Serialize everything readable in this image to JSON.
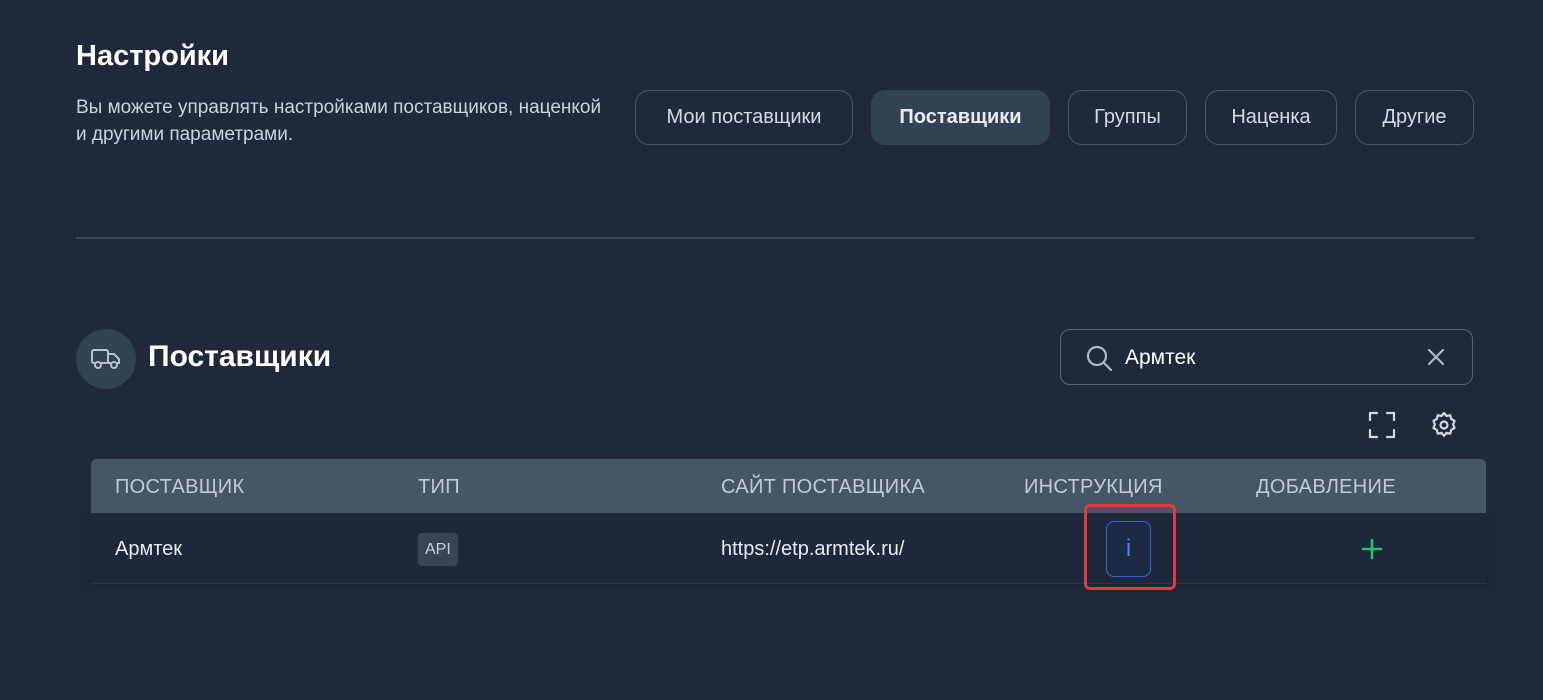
{
  "header": {
    "title": "Настройки",
    "description": "Вы можете управлять настройками поставщиков, наценкой и другими параметрами."
  },
  "tabs": [
    {
      "label": "Мои поставщики",
      "active": false
    },
    {
      "label": "Поставщики",
      "active": true
    },
    {
      "label": "Группы",
      "active": false
    },
    {
      "label": "Наценка",
      "active": false
    },
    {
      "label": "Другие",
      "active": false
    }
  ],
  "section": {
    "title": "Поставщики",
    "icon": "truck-icon"
  },
  "search": {
    "value": "Армтек",
    "icon": "search-icon",
    "clear_icon": "close-icon"
  },
  "toolbar": {
    "fullscreen_icon": "fullscreen-icon",
    "settings_icon": "gear-icon"
  },
  "table": {
    "columns": [
      "ПОСТАВЩИК",
      "ТИП",
      "САЙТ ПОСТАВЩИКА",
      "ИНСТРУКЦИЯ",
      "ДОБАВЛЕНИЕ"
    ],
    "rows": [
      {
        "supplier": "Армтек",
        "type": "API",
        "site": "https://etp.armtek.ru/",
        "instruction_label": "i",
        "add_icon": "plus-icon"
      }
    ]
  },
  "colors": {
    "background": "#1f293b",
    "header_row": "#475569",
    "active_tab": "#334155",
    "accent_blue": "#3b63d6",
    "add_green": "#22c55e",
    "highlight_red": "#de3b3b"
  }
}
